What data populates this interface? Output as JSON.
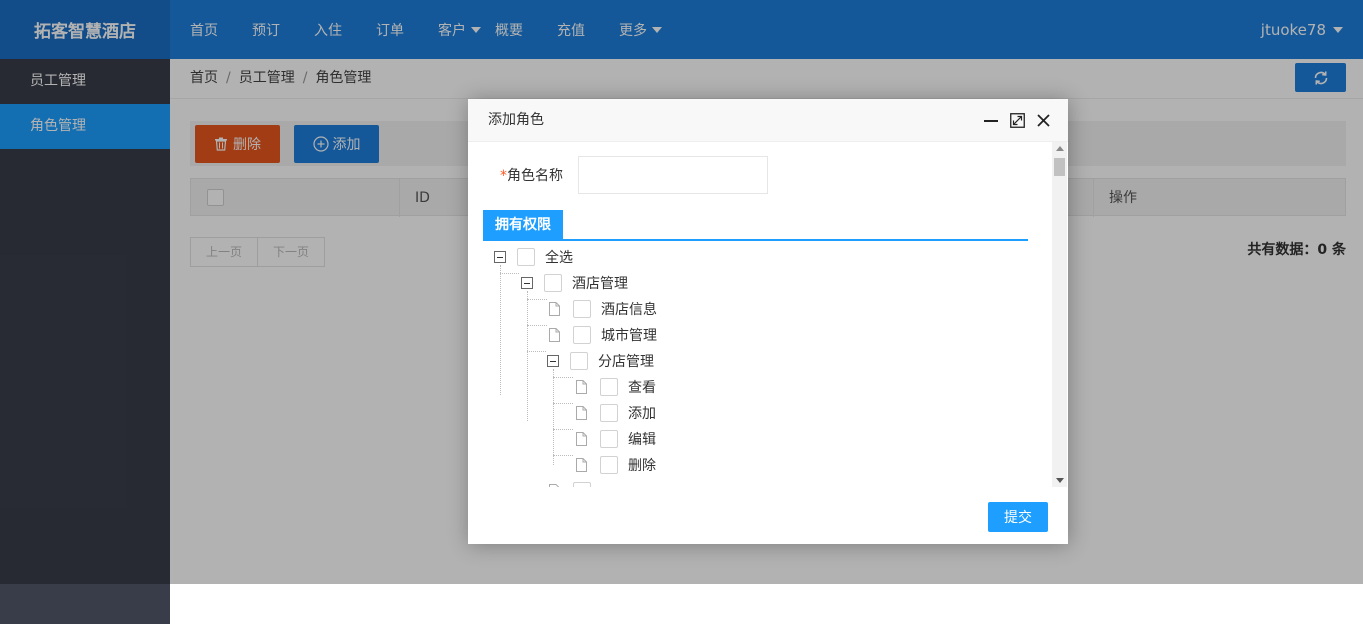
{
  "app": {
    "title": "拓客智慧酒店"
  },
  "topnav": {
    "items": [
      {
        "label": "首页"
      },
      {
        "label": "预订"
      },
      {
        "label": "入住"
      },
      {
        "label": "订单"
      },
      {
        "label": "客户"
      },
      {
        "label": "概要"
      },
      {
        "label": "充值"
      },
      {
        "label": "更多"
      }
    ],
    "user": "jtuoke78"
  },
  "sidebar": {
    "items": [
      {
        "label": "员工管理"
      },
      {
        "label": "角色管理"
      }
    ]
  },
  "breadcrumb": {
    "home": "首页",
    "section": "员工管理",
    "current": "角色管理",
    "separator": "/"
  },
  "toolbar": {
    "delete_label": "删除",
    "add_label": "添加"
  },
  "table": {
    "headers": {
      "id": "ID",
      "actions": "操作"
    }
  },
  "pager": {
    "prev": "上一页",
    "next": "下一页",
    "total": "共有数据：0 条"
  },
  "modal": {
    "title": "添加角色",
    "required_mark": "*",
    "name_label": "角色名称",
    "name_value": "",
    "perm_tab": "拥有权限",
    "tree": {
      "select_all": "全选",
      "hotel_mgmt": "酒店管理",
      "hotel_info": "酒店信息",
      "city_mgmt": "城市管理",
      "branch_mgmt": "分店管理",
      "view": "查看",
      "add": "添加",
      "edit": "编辑",
      "delete": "删除"
    },
    "submit_label": "提交"
  },
  "colors": {
    "topbar": "#1e7fdc",
    "sidebar": "#393d49",
    "sidebar_active": "#1e9fff",
    "delete_button": "#e8571e",
    "primary": "#1e9fff"
  }
}
